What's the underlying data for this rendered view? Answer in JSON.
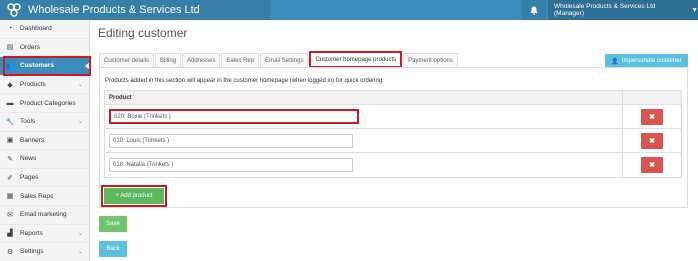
{
  "header": {
    "brand": "Wholesale Products & Services Ltd",
    "user_menu": "Wholesale Products & Services Ltd (Manager)",
    "accent": "#3c8dbc"
  },
  "sidebar": {
    "items": [
      {
        "label": "Dashboard",
        "icon": "dashboard-icon"
      },
      {
        "label": "Orders",
        "icon": "file-icon"
      },
      {
        "label": "Customers",
        "icon": "users-icon"
      },
      {
        "label": "Products",
        "icon": "tag-icon"
      },
      {
        "label": "Product Categories",
        "icon": "folder-icon"
      },
      {
        "label": "Tools",
        "icon": "wrench-icon"
      },
      {
        "label": "Banners",
        "icon": "image-icon"
      },
      {
        "label": "News",
        "icon": "pencil-icon"
      },
      {
        "label": "Pages",
        "icon": "edit-icon"
      },
      {
        "label": "Sales Reps",
        "icon": "briefcase-icon"
      },
      {
        "label": "Email marketing",
        "icon": "envelope-icon"
      },
      {
        "label": "Reports",
        "icon": "chart-icon"
      },
      {
        "label": "Settings",
        "icon": "gears-icon"
      }
    ]
  },
  "main": {
    "title": "Editing customer",
    "tabs": [
      "Customer details",
      "Billing",
      "Addresses",
      "Sales Rep",
      "Email Settings",
      "Customer homepage products",
      "Payment options"
    ],
    "impersonate_label": "Impersonate customer",
    "info_text": "Products added in this section will appear in the customer homepage (when logged in) for quick ordering",
    "table_header": "Product",
    "products": [
      "020: Boxie (Trinkets )",
      "019: Louis (Trinkets )",
      "018: Natalia (Trinkets )"
    ],
    "delete_glyph": "✖",
    "add_label": "+ Add product",
    "save_label": "Save",
    "back_label": "Back"
  }
}
